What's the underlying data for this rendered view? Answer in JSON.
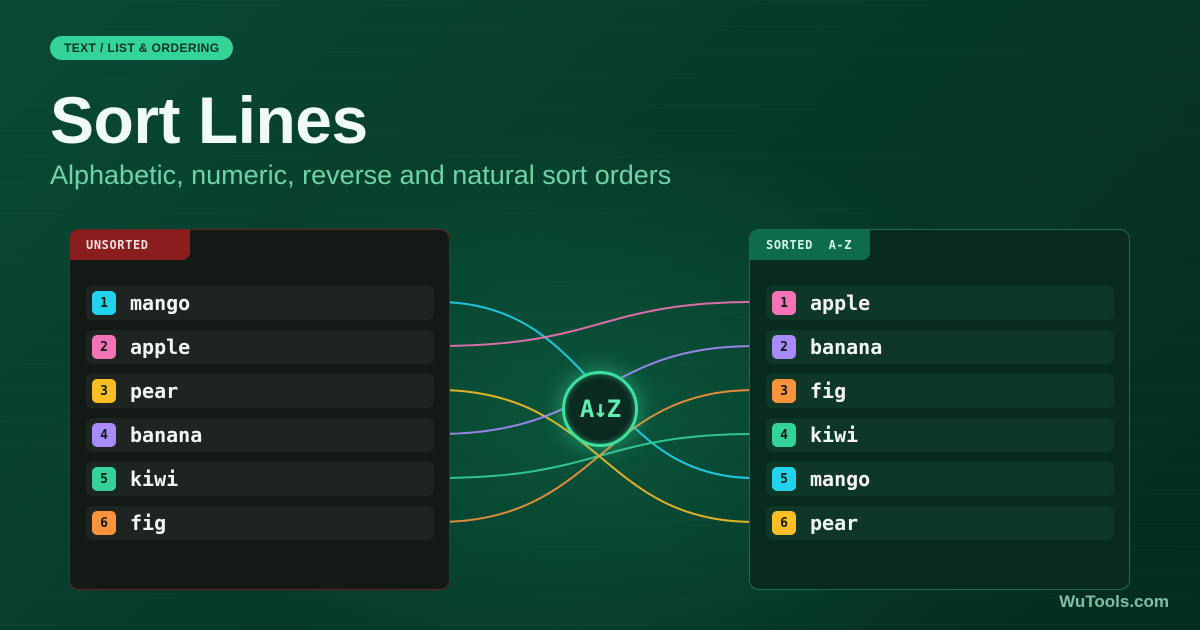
{
  "category_pill": "TEXT / LIST & ORDERING",
  "title": "Sort Lines",
  "subtitle": "Alphabetic, numeric, reverse and natural sort orders",
  "unsorted_panel": {
    "tab_label": "UNSORTED",
    "items": [
      {
        "index": "1",
        "text": "mango",
        "color": "#22d3ee"
      },
      {
        "index": "2",
        "text": "apple",
        "color": "#f472b6"
      },
      {
        "index": "3",
        "text": "pear",
        "color": "#fbbf24"
      },
      {
        "index": "4",
        "text": "banana",
        "color": "#a78bfa"
      },
      {
        "index": "5",
        "text": "kiwi",
        "color": "#34d399"
      },
      {
        "index": "6",
        "text": "fig",
        "color": "#fb923c"
      }
    ]
  },
  "sorted_panel": {
    "tab_label": "SORTED  A-Z",
    "items": [
      {
        "index": "1",
        "text": "apple",
        "color": "#f472b6"
      },
      {
        "index": "2",
        "text": "banana",
        "color": "#a78bfa"
      },
      {
        "index": "3",
        "text": "fig",
        "color": "#fb923c"
      },
      {
        "index": "4",
        "text": "kiwi",
        "color": "#34d399"
      },
      {
        "index": "5",
        "text": "mango",
        "color": "#22d3ee"
      },
      {
        "index": "6",
        "text": "pear",
        "color": "#fbbf24"
      }
    ]
  },
  "hub_label": "A↓Z",
  "brand": "WuTools.com",
  "colors": {
    "accent": "#34d399",
    "unsorted_border": "#6b2222",
    "sorted_border": "#1d6e50"
  }
}
